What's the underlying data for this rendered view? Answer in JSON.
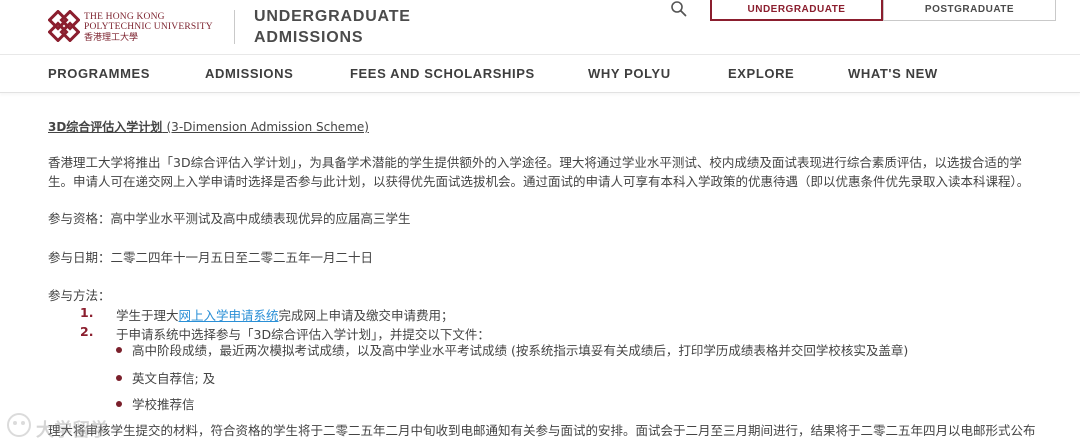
{
  "header": {
    "logo": {
      "line1": "THE HONG KONG",
      "line2": "POLYTECHNIC UNIVERSITY",
      "line3": "香港理工大學"
    },
    "site_title_line1": "UNDERGRADUATE",
    "site_title_line2": "ADMISSIONS",
    "search_icon": "search-icon",
    "tabs": [
      {
        "label": "UNDERGRADUATE",
        "active": true
      },
      {
        "label": "POSTGRADUATE",
        "active": false
      }
    ],
    "accent_color": "#8b1e2e"
  },
  "nav": {
    "items": [
      {
        "label": "PROGRAMMES"
      },
      {
        "label": "ADMISSIONS"
      },
      {
        "label": "FEES AND SCHOLARSHIPS"
      },
      {
        "label": "WHY POLYU"
      },
      {
        "label": "EXPLORE"
      },
      {
        "label": "WHAT'S NEW"
      }
    ]
  },
  "content": {
    "title_cn": "3D综合评估入学计划",
    "title_en": "(3-Dimension Admission Scheme)",
    "intro_line1": "香港理工大学将推出「3D综合评估入学计划」，为具备学术潜能的学生提供额外的入学途径。理大将通过学业水平测试、校内成绩及面试表现进行综合素质评估，以选拔合适的学",
    "intro_line2": "生。申请人可在递交网上入学申请时选择是否参与此计划，以获得优先面试选拔机会。通过面试的申请人可享有本科入学政策的优惠待遇（即以优惠条件优先录取入读本科课程）。",
    "eligibility": "参与资格：高中学业水平测试及高中成绩表现优异的应届高三学生",
    "dates": "参与日期：二零二四年十一月五日至二零二五年一月二十日",
    "method_label": "参与方法：",
    "steps": [
      {
        "num": "1.",
        "prefix": "学生于理大",
        "link": "网上入学申请系统",
        "suffix": "完成网上申请及缴交申请费用；"
      },
      {
        "num": "2.",
        "text": "于申请系统中选择参与「3D综合评估入学计划」，并提交以下文件："
      }
    ],
    "documents": [
      "高中阶段成绩，最近两次模拟考试成绩，以及高中学业水平考试成绩 (按系统指示填妥有关成绩后，打印学历成绩表格并交回学校核实及盖章)",
      "英文自荐信; 及",
      "学校推荐信"
    ],
    "closing": "理大将审核学生提交的材料，符合资格的学生将于二零二五年二月中旬收到电邮通知有关参与面试的安排。面试会于二月至三月期间进行，结果将于二零二五年四月以电邮形式公布"
  },
  "watermark": {
    "text": "大学留学"
  }
}
